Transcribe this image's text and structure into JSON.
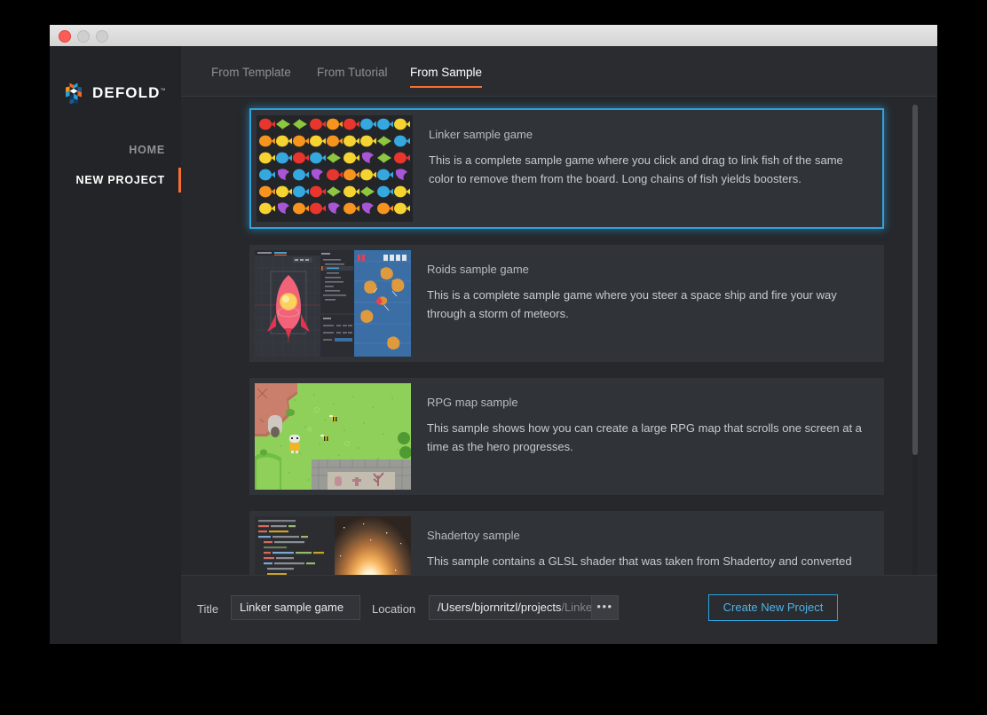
{
  "window": {
    "controls": [
      "close",
      "minimize",
      "maximize"
    ]
  },
  "sidebar": {
    "logo_text": "DEFOLD",
    "logo_tm": "™",
    "items": [
      {
        "label": "HOME",
        "active": false
      },
      {
        "label": "NEW PROJECT",
        "active": true
      }
    ]
  },
  "tabs": [
    {
      "label": "From Template",
      "active": false
    },
    {
      "label": "From Tutorial",
      "active": false
    },
    {
      "label": "From Sample",
      "active": true
    }
  ],
  "samples": [
    {
      "title": "Linker sample game",
      "description": "This is a complete sample game where you click and drag to link fish of the same color to remove them from the board. Long chains of fish yields boosters.",
      "selected": true,
      "thumbnail": "linker-fish-grid"
    },
    {
      "title": "Roids sample game",
      "description": "This is a complete sample game where you steer a space ship and fire your way through a storm of meteors.",
      "selected": false,
      "thumbnail": "roids-editor-rocket"
    },
    {
      "title": "RPG map sample",
      "description": "This sample shows how you can create a large RPG map that scrolls one screen at a time as the hero progresses.",
      "selected": false,
      "thumbnail": "rpg-green-map"
    },
    {
      "title": "Shadertoy sample",
      "description": "This sample contains a GLSL shader that was taken from Shadertoy and converted to Defold. It",
      "selected": false,
      "thumbnail": "shadertoy-nebula"
    }
  ],
  "bottom_bar": {
    "title_label": "Title",
    "title_value": "Linker sample game",
    "location_label": "Location",
    "location_path": "/Users/bjornritzl/projects",
    "location_project": "/Linker sample game",
    "browse_label": "•••",
    "create_label": "Create New Project"
  },
  "colors": {
    "accent_orange": "#fa6e32",
    "accent_blue": "#2ea3e0",
    "panel_bg": "#26282c",
    "card_bg": "#303338",
    "sidebar_bg": "#222427"
  },
  "scroll": {
    "thumb_percent": 72
  }
}
